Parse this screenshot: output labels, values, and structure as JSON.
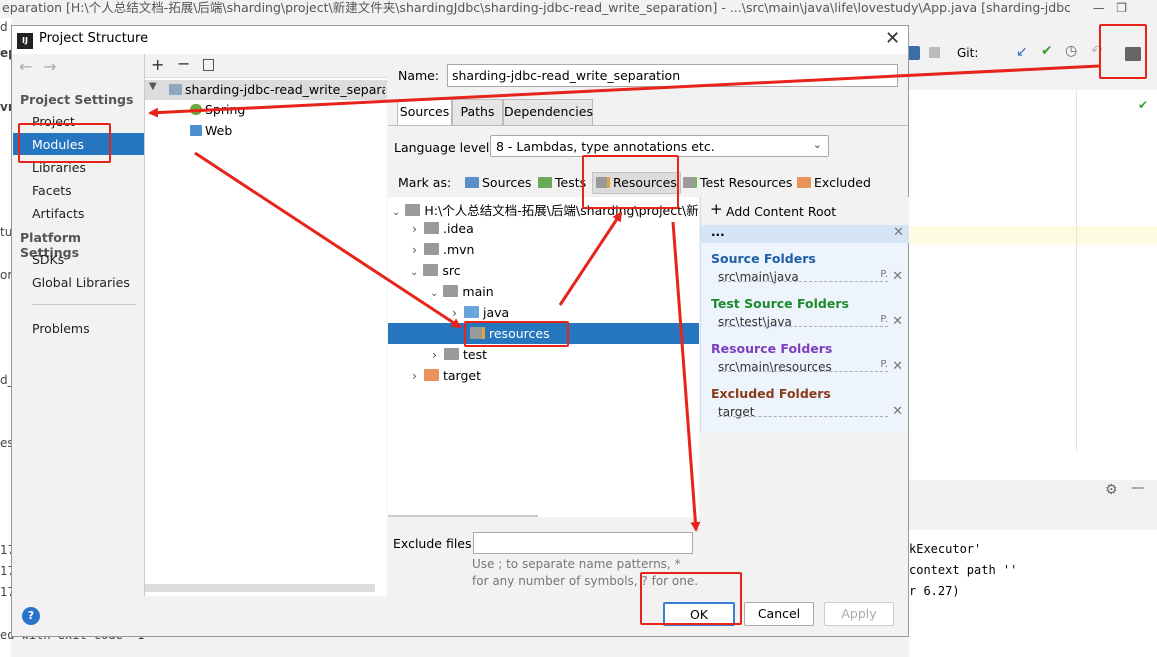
{
  "ide": {
    "window_title": "eparation [H:\\个人总结文档-拓展\\后端\\sharding\\project\\新建文件夹\\shardingJdbc\\sharding-jdbc-read_write_separation] - ...\\src\\main\\java\\life\\lovestudy\\App.java [sharding-jdbc-re...",
    "git_label": "Git:",
    "console_lines": [
      "kExecutor'",
      "context path ''",
      "r 6.27)"
    ],
    "left_fragments": [
      "d",
      "ep",
      "vri",
      "tu",
      "or",
      "d_",
      "es",
      "17",
      "17",
      "17",
      "ed with exit code -1"
    ]
  },
  "dialog": {
    "title": "Project Structure",
    "nav": {
      "project_settings_heading": "Project Settings",
      "project_settings": [
        "Project",
        "Modules",
        "Libraries",
        "Facets",
        "Artifacts"
      ],
      "platform_settings_heading": "Platform Settings",
      "platform_settings": [
        "SDKs",
        "Global Libraries"
      ],
      "problems": "Problems",
      "selected": "Modules"
    },
    "module_tree": {
      "module": "sharding-jdbc-read_write_separatic",
      "facets": [
        "Spring",
        "Web"
      ]
    },
    "name_label": "Name:",
    "name_value": "sharding-jdbc-read_write_separation",
    "tabs": [
      "Sources",
      "Paths",
      "Dependencies"
    ],
    "active_tab": "Sources",
    "language_level_label": "Language level:",
    "language_level_value": "8 - Lambdas, type annotations etc.",
    "mark_as_label": "Mark as:",
    "mark_as": [
      "Sources",
      "Tests",
      "Resources",
      "Test Resources",
      "Excluded"
    ],
    "file_tree": {
      "root": "H:\\个人总结文档-拓展\\后端\\sharding\\project\\新建",
      "items": [
        ".idea",
        ".mvn",
        "src",
        "main",
        "java",
        "resources",
        "test",
        "target"
      ],
      "selected": "resources"
    },
    "content_root": {
      "add_label": "Add Content Root",
      "root_label": "...",
      "source_heading": "Source Folders",
      "source_path": "src\\main\\java",
      "test_heading": "Test Source Folders",
      "test_path": "src\\test\\java",
      "resource_heading": "Resource Folders",
      "resource_path": "src\\main\\resources",
      "excluded_heading": "Excluded Folders",
      "excluded_path": "target",
      "p_mark": "P."
    },
    "exclude_label": "Exclude files:",
    "exclude_hint_1": "Use ; to separate name patterns, *",
    "exclude_hint_2": "for any number of symbols, ? for one.",
    "buttons": {
      "ok": "OK",
      "cancel": "Cancel",
      "apply": "Apply"
    },
    "help": "?"
  },
  "colors": {
    "selection": "#2675bf",
    "annotation_red": "#e8231a",
    "source_blue": "#1e5fa8",
    "test_green": "#1d8a2e",
    "resource_purple": "#7b3fbf",
    "excluded_brown": "#8a3b1a"
  }
}
